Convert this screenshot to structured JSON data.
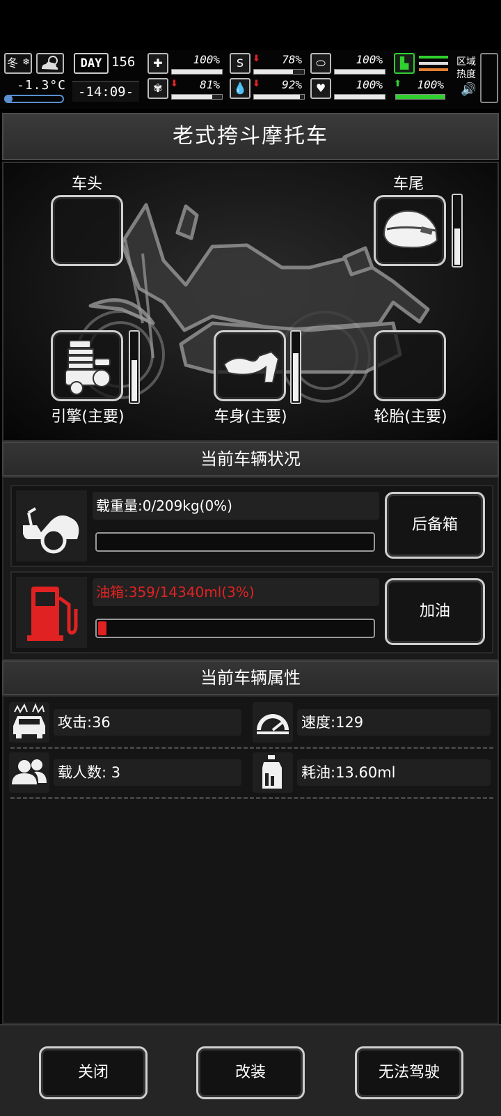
{
  "hud": {
    "season": "冬",
    "temperature": "-1.3°C",
    "day_badge": "DAY",
    "day": "156",
    "time": "-14:09-",
    "region_label": "区域热度",
    "stats": [
      {
        "icon": "medkit-icon",
        "arrow": "",
        "value": "100%",
        "level": 1.0
      },
      {
        "icon": "stomach-icon",
        "arrow": "down",
        "value": "78%",
        "level": 0.78
      },
      {
        "icon": "capsule-icon",
        "arrow": "",
        "value": "100%",
        "level": 1.0
      },
      {
        "icon": "brain-icon",
        "arrow": "down",
        "value": "81%",
        "level": 0.81
      },
      {
        "icon": "water-drop-icon",
        "arrow": "down",
        "value": "92%",
        "level": 0.92
      },
      {
        "icon": "heart-icon",
        "arrow": "",
        "value": "100%",
        "level": 1.0
      },
      {
        "icon": "stamina-boot-icon",
        "arrow": "up",
        "value": "100%",
        "level": 1.0
      }
    ]
  },
  "title": "老式挎斗摩托车",
  "parts": {
    "front_label": "车头",
    "rear_label": "车尾",
    "engine_label": "引擎(主要)",
    "body_label": "车身(主要)",
    "tire_label": "轮胎(主要)",
    "rear_durability": 0.55,
    "engine_durability": 0.62,
    "body_durability": 0.72
  },
  "status": {
    "section_title": "当前车辆状况",
    "load_label": "载重量:0/209kg(0%)",
    "load_fraction": 0.0,
    "load_button": "后备箱",
    "fuel_label": "油箱:359/14340ml(3%)",
    "fuel_fraction": 0.03,
    "fuel_button": "加油",
    "accent_red": "#e02222"
  },
  "attributes": {
    "section_title": "当前车辆属性",
    "attack": "攻击:36",
    "speed": "速度:129",
    "passengers": "载人数:  3",
    "fuel_consumption": "耗油:13.60ml"
  },
  "buttons": {
    "close": "关闭",
    "modify": "改装",
    "drive": "无法驾驶"
  }
}
